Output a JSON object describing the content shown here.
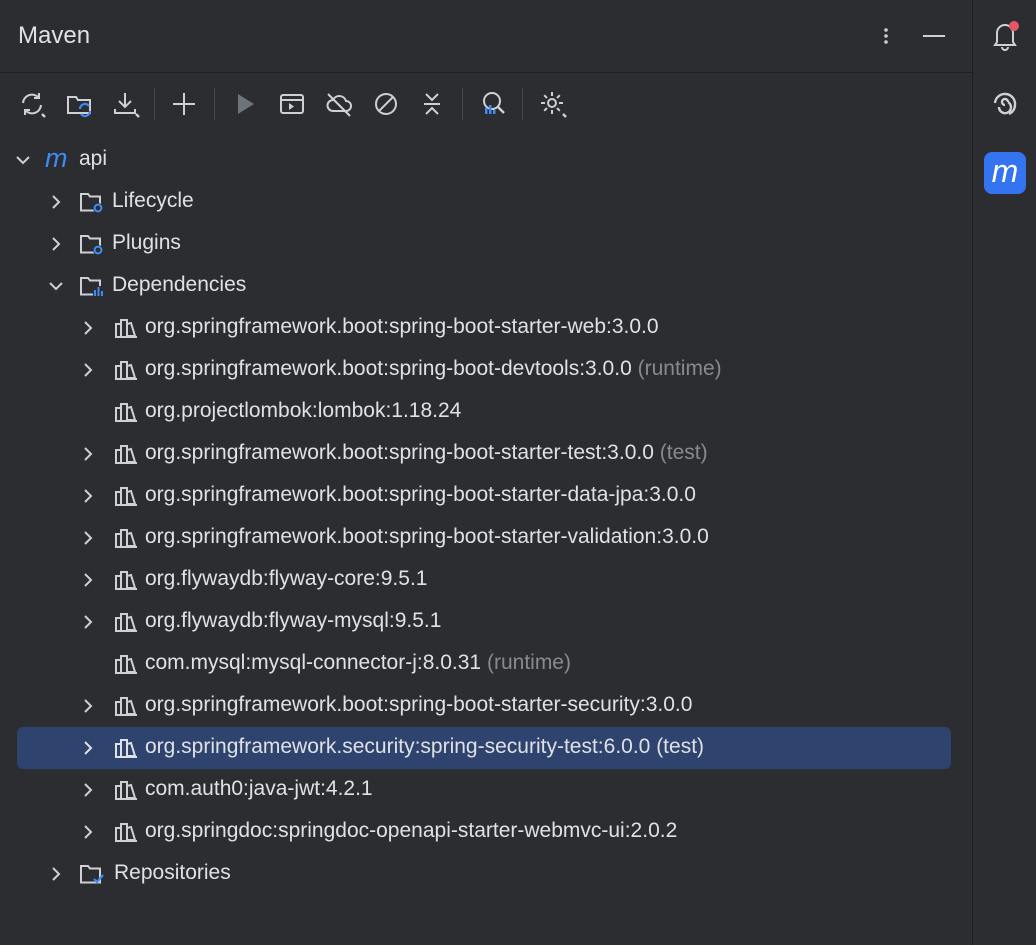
{
  "panel": {
    "title": "Maven"
  },
  "header": {
    "more_icon": "more-vertical-icon",
    "hide_icon": "minimize-icon"
  },
  "toolbar": {
    "buttons": [
      {
        "name": "reload-all-projects-button",
        "icon": "reload-icon"
      },
      {
        "name": "generate-sources-button",
        "icon": "folder-refresh-icon"
      },
      {
        "name": "download-sources-button",
        "icon": "download-icon"
      },
      {
        "name": "add-maven-project-button",
        "icon": "plus-icon"
      },
      {
        "name": "run-maven-build-button",
        "icon": "run-icon"
      },
      {
        "name": "execute-maven-goal-button",
        "icon": "execute-goal-icon"
      },
      {
        "name": "toggle-offline-mode-button",
        "icon": "offline-cloud-icon"
      },
      {
        "name": "skip-tests-button",
        "icon": "skip-icon"
      },
      {
        "name": "collapse-all-button",
        "icon": "collapse-icon"
      },
      {
        "name": "analyze-dependencies-button",
        "icon": "analyze-icon"
      },
      {
        "name": "maven-settings-button",
        "icon": "gear-icon"
      }
    ]
  },
  "tree": {
    "root": "api",
    "nodes": [
      {
        "label": "Lifecycle",
        "suffix": ""
      },
      {
        "label": "Plugins",
        "suffix": ""
      },
      {
        "label": "Dependencies",
        "suffix": ""
      },
      {
        "label": "org.springframework.boot:spring-boot-starter-web:3.0.0",
        "suffix": ""
      },
      {
        "label": "org.springframework.boot:spring-boot-devtools:3.0.0",
        "suffix": "(runtime)"
      },
      {
        "label": "org.projectlombok:lombok:1.18.24",
        "suffix": ""
      },
      {
        "label": "org.springframework.boot:spring-boot-starter-test:3.0.0",
        "suffix": "(test)"
      },
      {
        "label": "org.springframework.boot:spring-boot-starter-data-jpa:3.0.0",
        "suffix": ""
      },
      {
        "label": "org.springframework.boot:spring-boot-starter-validation:3.0.0",
        "suffix": ""
      },
      {
        "label": "org.flywaydb:flyway-core:9.5.1",
        "suffix": ""
      },
      {
        "label": "org.flywaydb:flyway-mysql:9.5.1",
        "suffix": ""
      },
      {
        "label": "com.mysql:mysql-connector-j:8.0.31",
        "suffix": "(runtime)"
      },
      {
        "label": "org.springframework.boot:spring-boot-starter-security:3.0.0",
        "suffix": ""
      },
      {
        "label": "org.springframework.security:spring-security-test:6.0.0",
        "suffix": "(test)"
      },
      {
        "label": "com.auth0:java-jwt:4.2.1",
        "suffix": ""
      },
      {
        "label": "org.springdoc:springdoc-openapi-starter-webmvc-ui:2.0.2",
        "suffix": ""
      },
      {
        "label": "Repositories",
        "suffix": ""
      }
    ]
  },
  "sidebar": {
    "items": [
      {
        "name": "notifications-button",
        "icon": "bell-icon"
      },
      {
        "name": "ai-assistant-button",
        "icon": "spiral-icon"
      },
      {
        "name": "maven-tool-button",
        "icon": "maven-icon"
      }
    ]
  },
  "colors": {
    "background": "#2b2d30",
    "selection": "#2e436e",
    "accent": "#3574f0",
    "text": "#dfe1e5",
    "muted": "#868a91",
    "notification_dot": "#e55765"
  }
}
